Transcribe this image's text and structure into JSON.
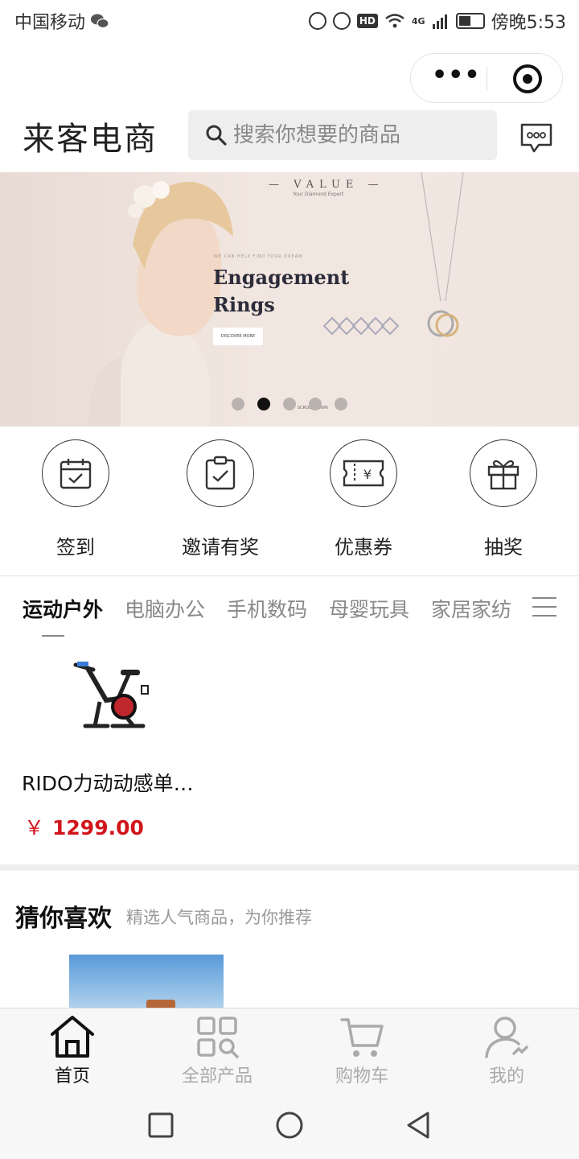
{
  "status_bar": {
    "carrier": "中国移动",
    "time": "傍晚5:53",
    "network": "4G",
    "hd": "HD"
  },
  "capsule": {
    "more_icon": "ellipsis-icon",
    "close_icon": "target-icon"
  },
  "header": {
    "logo": "来客电商",
    "search_placeholder": "搜索你想要的商品",
    "message_icon": "chat-bubble-icon"
  },
  "banner": {
    "brand": "— VALUE —",
    "brand_sub": "Your Diamond Expert",
    "tagline": "WE CAN HELP FIND YOUR DREAM",
    "headline_line1": "Engagement",
    "headline_line2": "Rings",
    "cta": "DISCOVER MORE",
    "scroll": "SCROLL DOWN",
    "slide_count": 5,
    "active_slide": 2
  },
  "quick_actions": [
    {
      "label": "签到",
      "icon": "calendar-check-icon"
    },
    {
      "label": "邀请有奖",
      "icon": "clipboard-check-icon"
    },
    {
      "label": "优惠券",
      "icon": "coupon-ticket-icon"
    },
    {
      "label": "抽奖",
      "icon": "gift-icon"
    }
  ],
  "category_tabs": [
    {
      "label": "运动户外",
      "active": true
    },
    {
      "label": "电脑办公",
      "active": false
    },
    {
      "label": "手机数码",
      "active": false
    },
    {
      "label": "母婴玩具",
      "active": false
    },
    {
      "label": "家居家纺",
      "active": false
    }
  ],
  "product": {
    "name": "RIDO力动动感单…",
    "currency": "￥",
    "price": "1299.00"
  },
  "recommend": {
    "title": "猜你喜欢",
    "subtitle": "精选人气商品，为你推荐"
  },
  "tabbar": [
    {
      "label": "首页",
      "icon": "home-icon",
      "active": true
    },
    {
      "label": "全部产品",
      "icon": "grid-search-icon",
      "active": false
    },
    {
      "label": "购物车",
      "icon": "cart-icon",
      "active": false
    },
    {
      "label": "我的",
      "icon": "user-icon",
      "active": false
    }
  ],
  "colors": {
    "price_red": "#d2141b",
    "active_text": "#111111",
    "inactive_text": "#888888"
  }
}
